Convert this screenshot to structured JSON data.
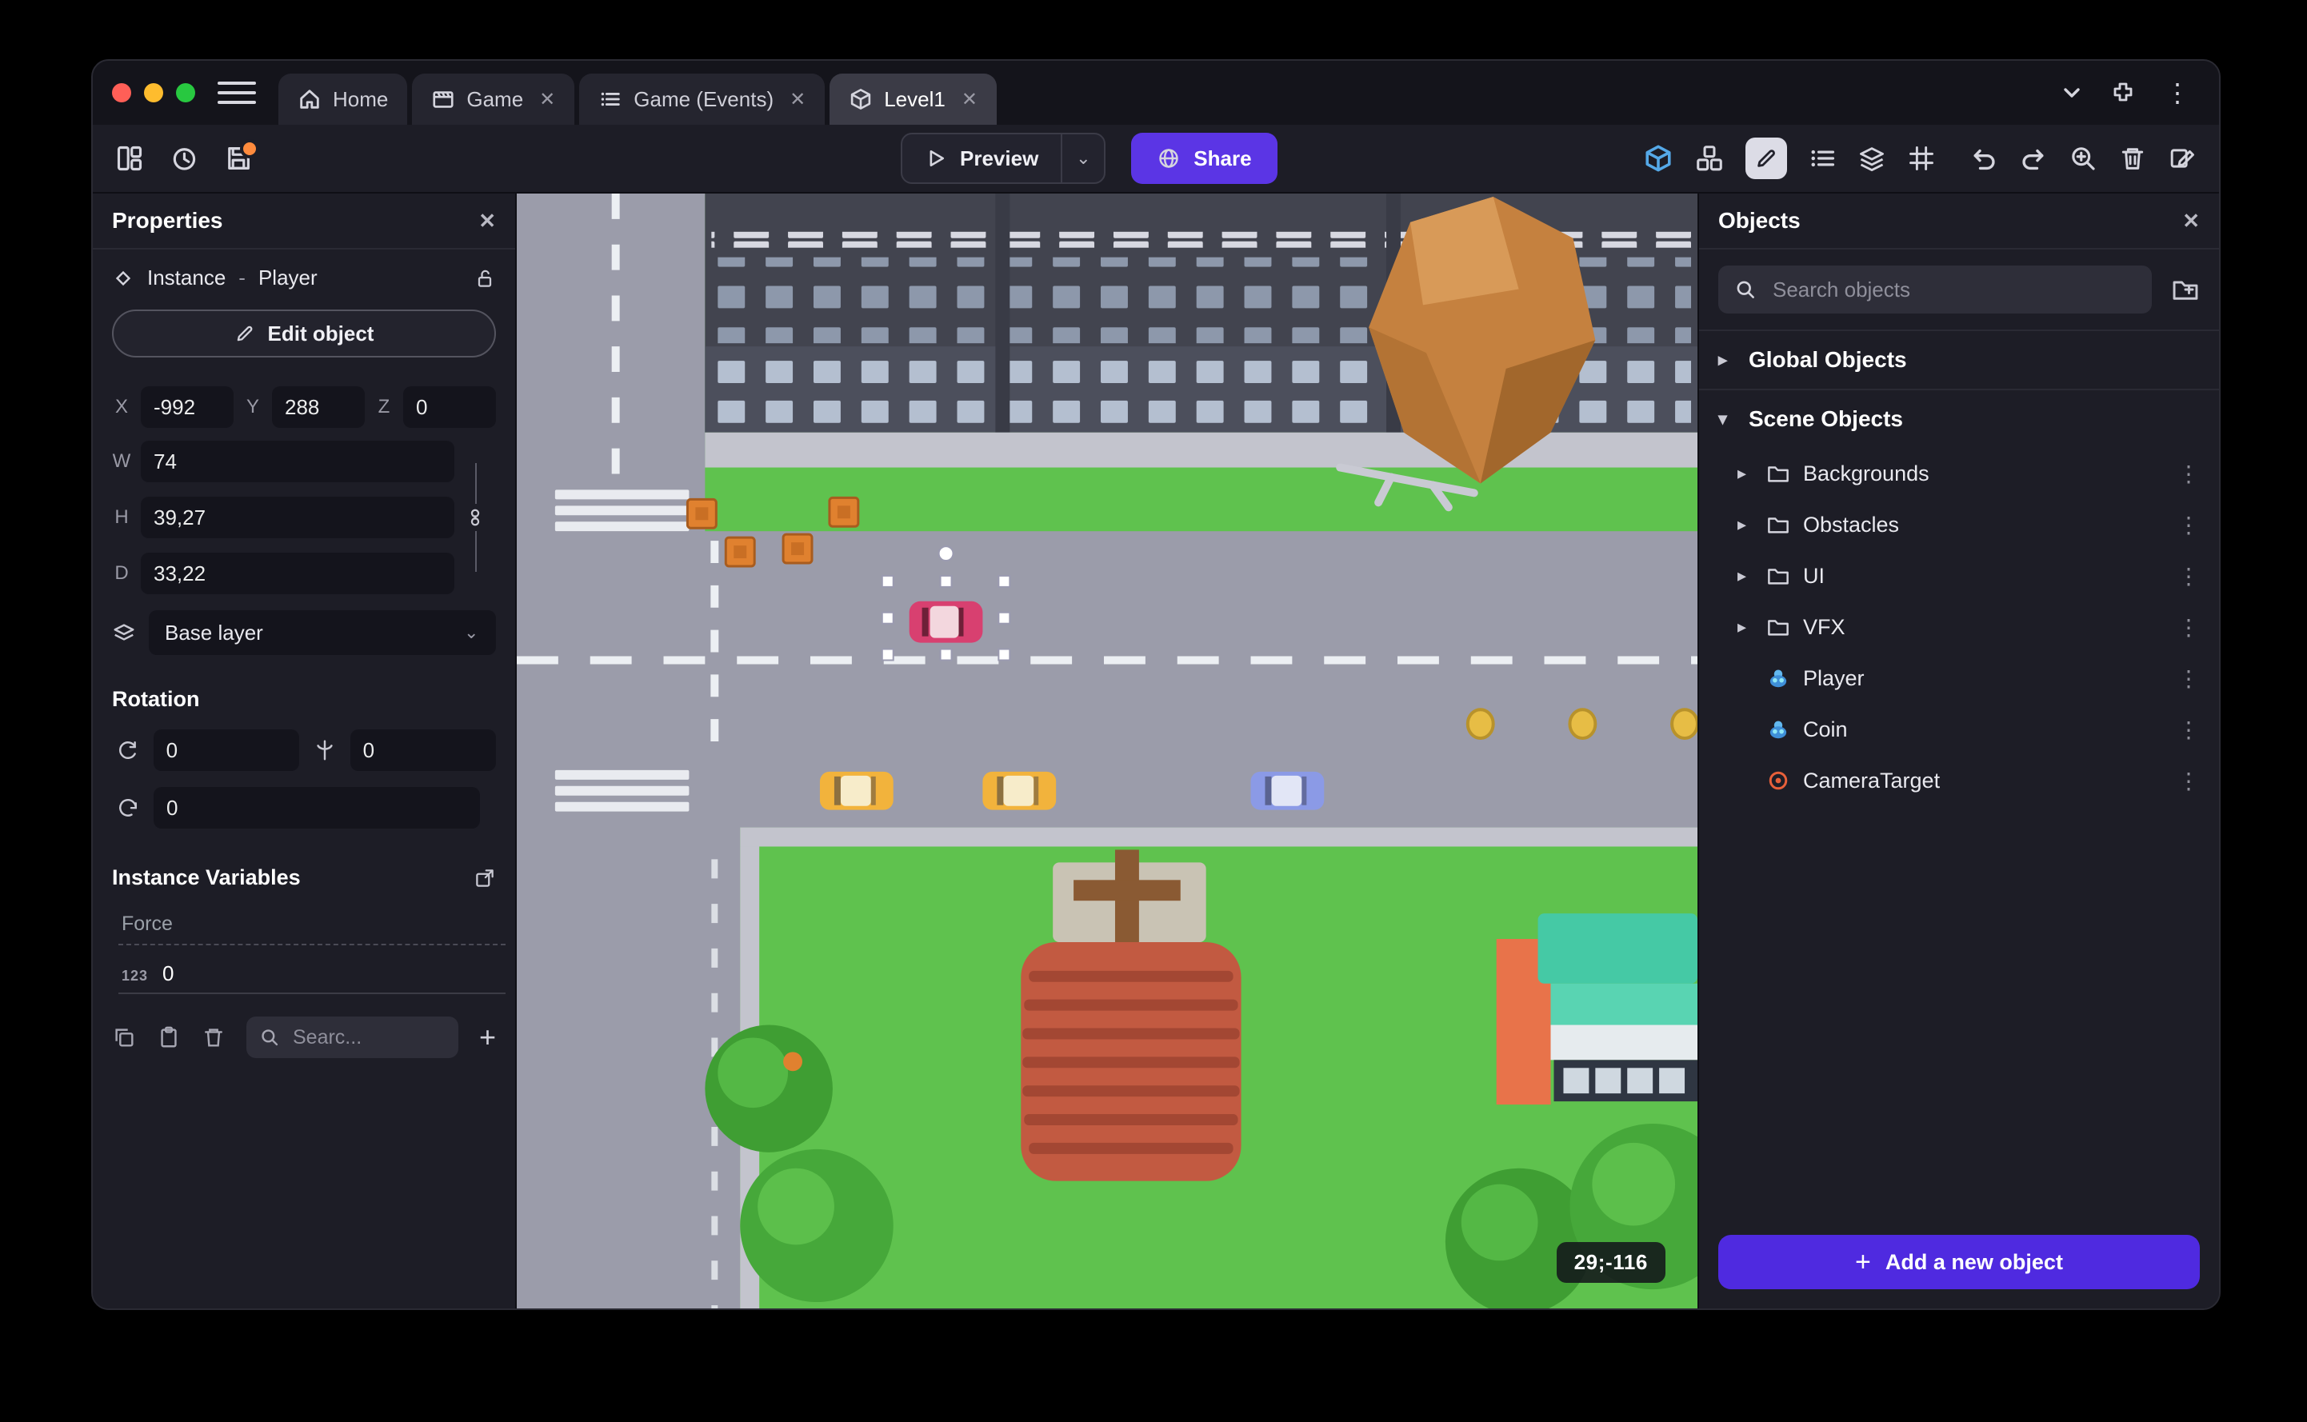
{
  "ui": {
    "glyphs": {
      "close": "✕",
      "kebab": "⋮",
      "plus": "+",
      "chevron_right": "▸",
      "chevron_down": "▾",
      "dropdown": "⌄"
    }
  },
  "window": {
    "tabs": [
      {
        "label": "Home"
      },
      {
        "label": "Game"
      },
      {
        "label": "Game (Events)"
      },
      {
        "label": "Level1"
      }
    ]
  },
  "toolbar": {
    "preview": "Preview",
    "share": "Share"
  },
  "properties": {
    "title": "Properties",
    "instance_label": "Instance",
    "separator": "-",
    "object_name": "Player",
    "edit_object": "Edit object",
    "x_label": "X",
    "x": "-992",
    "y_label": "Y",
    "y": "288",
    "z_label": "Z",
    "z": "0",
    "w_label": "W",
    "w": "74",
    "h_label": "H",
    "h": "39,27",
    "d_label": "D",
    "d": "33,22",
    "layer": "Base layer",
    "rotation_title": "Rotation",
    "rot_x": "0",
    "rot_y": "0",
    "rot_z": "0",
    "variables_title": "Instance Variables",
    "variable_name": "Force",
    "variable_type": "123",
    "variable_value": "0",
    "search_placeholder": "Searc..."
  },
  "canvas": {
    "coordinates": "29;-116"
  },
  "objects": {
    "title": "Objects",
    "search_placeholder": "Search objects",
    "global_group": "Global Objects",
    "scene_group": "Scene Objects",
    "items": [
      {
        "label": "Backgrounds"
      },
      {
        "label": "Obstacles"
      },
      {
        "label": "UI"
      },
      {
        "label": "VFX"
      },
      {
        "label": "Player"
      },
      {
        "label": "Coin"
      },
      {
        "label": "CameraTarget"
      }
    ],
    "add_button": "Add a new object"
  },
  "colors": {
    "accent_purple": "#5b35e5",
    "add_button_purple": "#4f2ae0",
    "active_tool_blue": "#55a9e8",
    "traffic_red": "#ff5f57",
    "traffic_yellow": "#febc2e",
    "traffic_green": "#28c840",
    "grass_green": "#5fc24e",
    "road_gray": "#9b9caa",
    "selected_car_red": "#d84070",
    "camera_target_orange": "#e8603a"
  }
}
